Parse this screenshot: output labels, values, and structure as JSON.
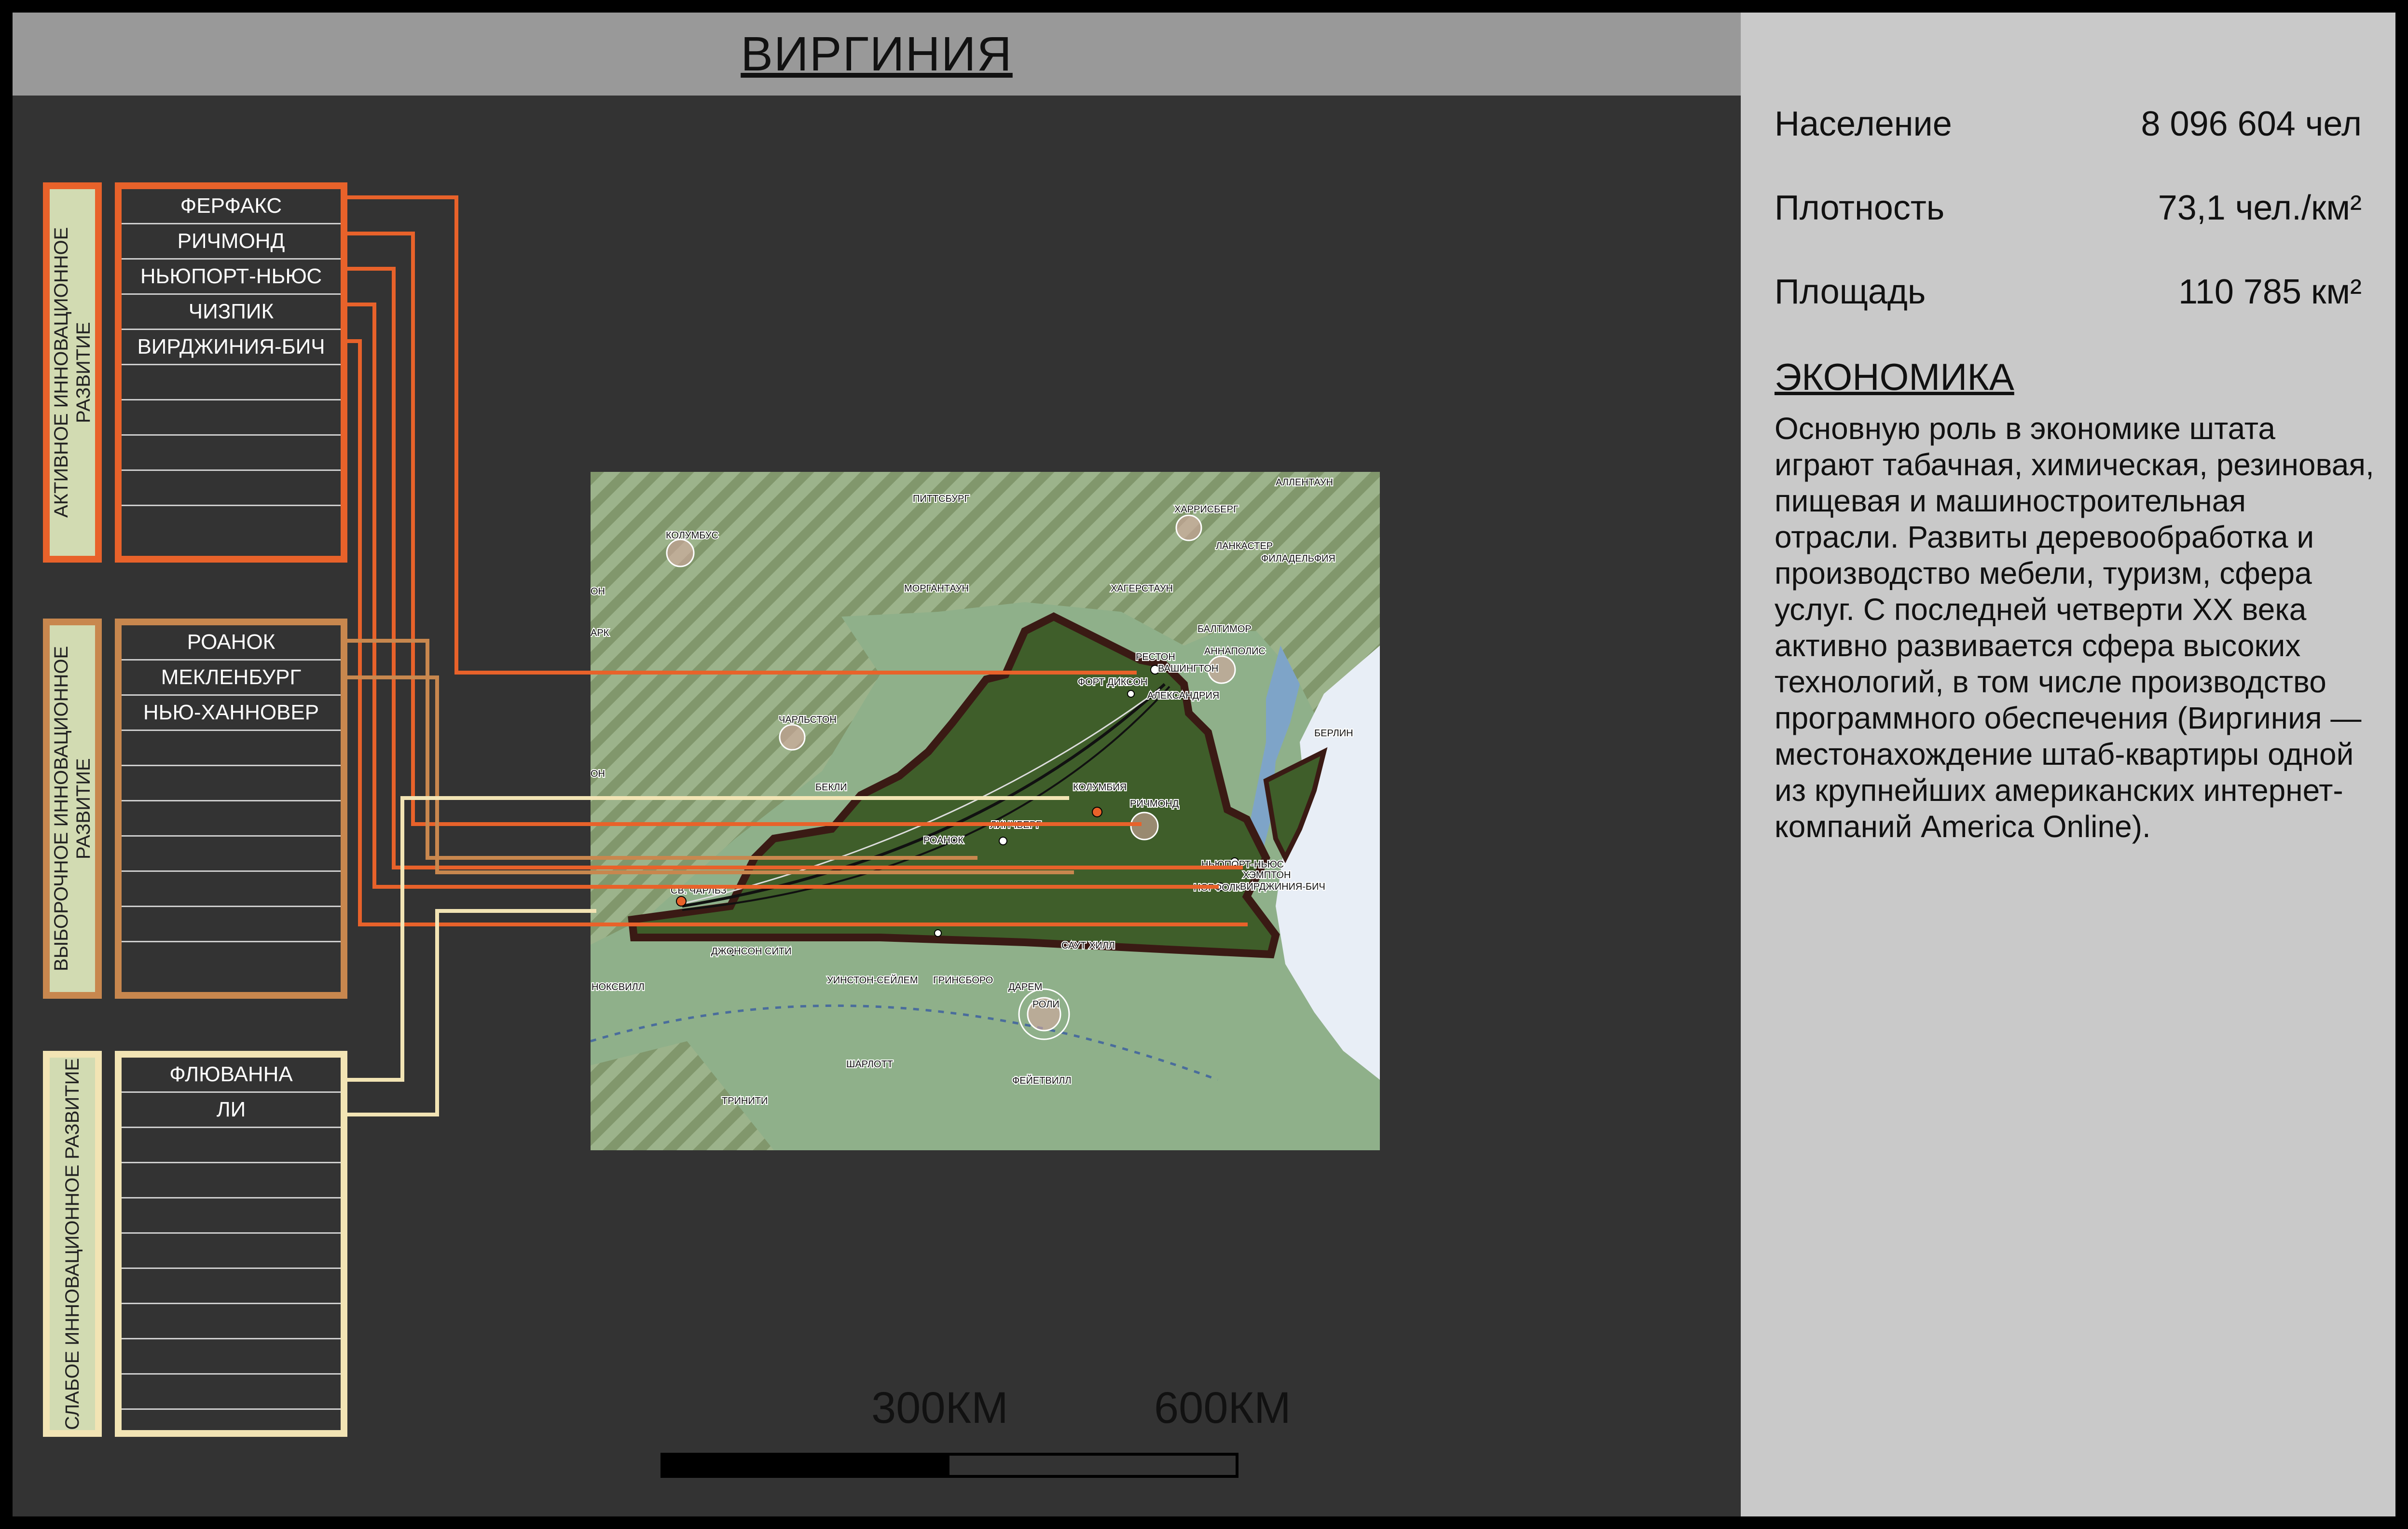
{
  "title": "ВИРГИНИЯ",
  "stats": [
    {
      "label": "Население",
      "value": "8 096 604 чел"
    },
    {
      "label": "Плотность",
      "value": "73,1 чел./км²"
    },
    {
      "label": "Площадь",
      "value": "110 785 км²"
    }
  ],
  "economy": {
    "heading": "ЭКОНОМИКА",
    "text": "Основную роль в экономике штата играют табачная, химическая, резиновая, пищевая и машиностроительная отрасли. Развиты деревообработка и производство мебели, туризм, сфера услуг. С последней четверти XX века активно развивается сфера высоких технологий, в том числе производство программного обеспечения (Виргиния — местонахождение штаб-квартиры одной из крупнейших американских интернет-компаний America Online)."
  },
  "groups": [
    {
      "label": "АКТИВНОЕ ИННОВАЦИОННОЕ РАЗВИТИЕ",
      "color": "#e8622a",
      "items": [
        "ФЕРФАКС",
        "РИЧМОНД",
        "НЬЮПОРТ-НЬЮС",
        "ЧИЗПИК",
        "ВИРДЖИНИЯ-БИЧ"
      ]
    },
    {
      "label": "ВЫБОРОЧНОЕ ИННОВАЦИОННОЕ РАЗВИТИЕ",
      "color": "#c8874e",
      "items": [
        "РОАНОК",
        "МЕКЛЕНБУРГ",
        "НЬЮ-ХАННОВЕР"
      ]
    },
    {
      "label": "СЛАБОЕ ИННОВАЦИОННОЕ РАЗВИТИЕ",
      "color": "#f2e4b4",
      "items": [
        "ФЛЮВАННА",
        "ЛИ"
      ]
    }
  ],
  "map_labels": {
    "pittsburgh": "ПИТТСБУРГ",
    "harrisburg": "ХАРРИСБЕРГ",
    "allentown": "АЛЛЕНТАУН",
    "columbus": "КОЛУМБУС",
    "lancaster": "ЛАНКАСТЕР",
    "philadelphia": "ФИЛАДЕЛЬФИЯ",
    "morgantown": "МОРГАНТАУН",
    "hagerstown": "ХАГЕРСТАУН",
    "baltimore": "БАЛТИМОР",
    "annapolis": "АННАПОЛИС",
    "reston": "РЕСТОН",
    "washington": "ВАШИНГТОН",
    "fort_dick": "ФОРТ ДИКСОН",
    "alexandria": "АЛЕКСАНДРИЯ",
    "charleston": "ЧАРЛЬСТОН",
    "berlin": "БЕРЛИН",
    "beckley": "БЕКЛИ",
    "columbia": "КОЛУМБИЯ",
    "richmond": "РИЧМОНД",
    "lynchburg": "ЛИНЧБЕРГ",
    "roanoke": "РОАНОК",
    "newport_news": "НЬЮПОРТ-НЬЮС",
    "hampton": "ХЭМПТОН",
    "norfolk": "НОРФОЛК",
    "virginia_beach": "ВИРДЖИНИЯ-БИЧ",
    "st_charles": "СВ. ЧАРЛЬЗ",
    "johnson_city": "ДЖОНСОН СИТИ",
    "knoxville": "НОКСВИЛЛ",
    "winston": "УИНСТОН-СЕЙЛЕМ",
    "greensboro": "ГРИНСБОРО",
    "durham": "ДАРЕМ",
    "raleigh": "РОЛИ",
    "south_hill": "САУТ ХИЛЛ",
    "charlotte": "ШАРЛОТТ",
    "fayetteville": "ФЕЙЕТВИЛЛ",
    "trinity": "ТРИНИТИ",
    "ark": "АРК",
    "on1": "ОН",
    "on2": "ОН"
  },
  "scale": {
    "label_300": "300КМ",
    "label_600": "600КМ"
  },
  "colors": {
    "active": "#e8622a",
    "selective": "#c8874e",
    "weak": "#f2e4b4",
    "panel": "#c9c9c9",
    "background": "#333333"
  }
}
